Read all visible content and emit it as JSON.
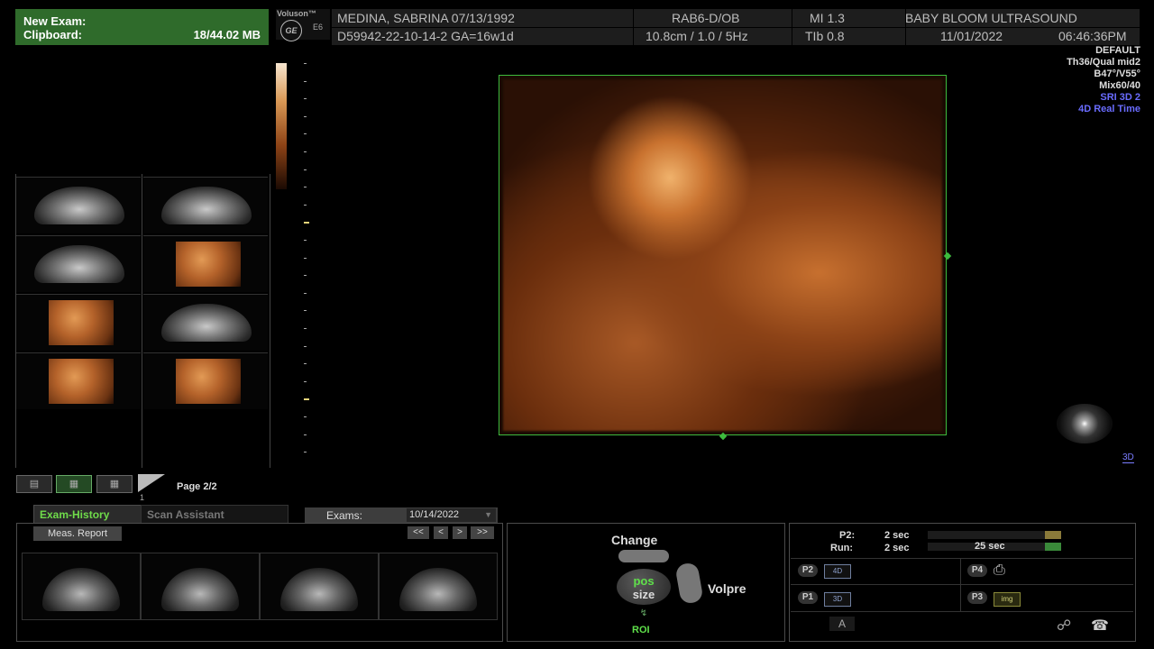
{
  "clipboard": {
    "line1": "New Exam:",
    "line2": "Clipboard:",
    "size": "18/44.02 MB"
  },
  "branding": {
    "product": "Voluson™",
    "model": "E6",
    "logo_text": "GE"
  },
  "header": {
    "patient": "MEDINA, SABRINA  07/13/1992",
    "id": "D59942-22-10-14-2  GA=16w1d",
    "probe": "RAB6-D/OB",
    "depth": "10.8cm / 1.0 /  5Hz",
    "mi": "MI  1.3",
    "tib": "TIb  0.8",
    "institution": "BABY BLOOM ULTRASOUND",
    "date": "11/01/2022",
    "time": "06:46:36PM"
  },
  "image_params": [
    "DEFAULT",
    "Th36/Qual mid2",
    "B47°/V55°",
    "Mix60/40"
  ],
  "image_modes": [
    "SRI 3D 2",
    "4D Real Time"
  ],
  "mode_label": "3D",
  "page": {
    "label": "Page 2/2",
    "tick": "1"
  },
  "tabs": {
    "exam_history": "Exam-History",
    "scan_assistant": "Scan Assistant"
  },
  "exams": {
    "label": "Exams:",
    "value": "10/14/2022"
  },
  "history": {
    "meas_report": "Meas. Report",
    "nav": [
      "<<",
      "<",
      ">",
      ">>"
    ]
  },
  "change_panel": {
    "change": "Change",
    "pos": "pos",
    "size": "size",
    "volpre": "Volpre",
    "roi": "ROI"
  },
  "p_panel": {
    "p2_label": "P2:",
    "p2_value": "2 sec",
    "run_label": "Run:",
    "run_value": "2 sec",
    "run_total": "25 sec",
    "buttons": {
      "p1": "P1",
      "p2": "P2",
      "p3": "P3",
      "p4": "P4"
    },
    "icons": {
      "p1": "3D",
      "p2": "4D",
      "p3": "img",
      "p4": "print-icon"
    },
    "a_label": "A",
    "colors": {
      "p2_fill": "#8a7a3a",
      "run_fill": "#3a8a3a"
    }
  },
  "colors": {
    "accent_green": "#5fe04a",
    "roi_green": "#3dbb3d",
    "mode_blue": "#6a6cff"
  }
}
